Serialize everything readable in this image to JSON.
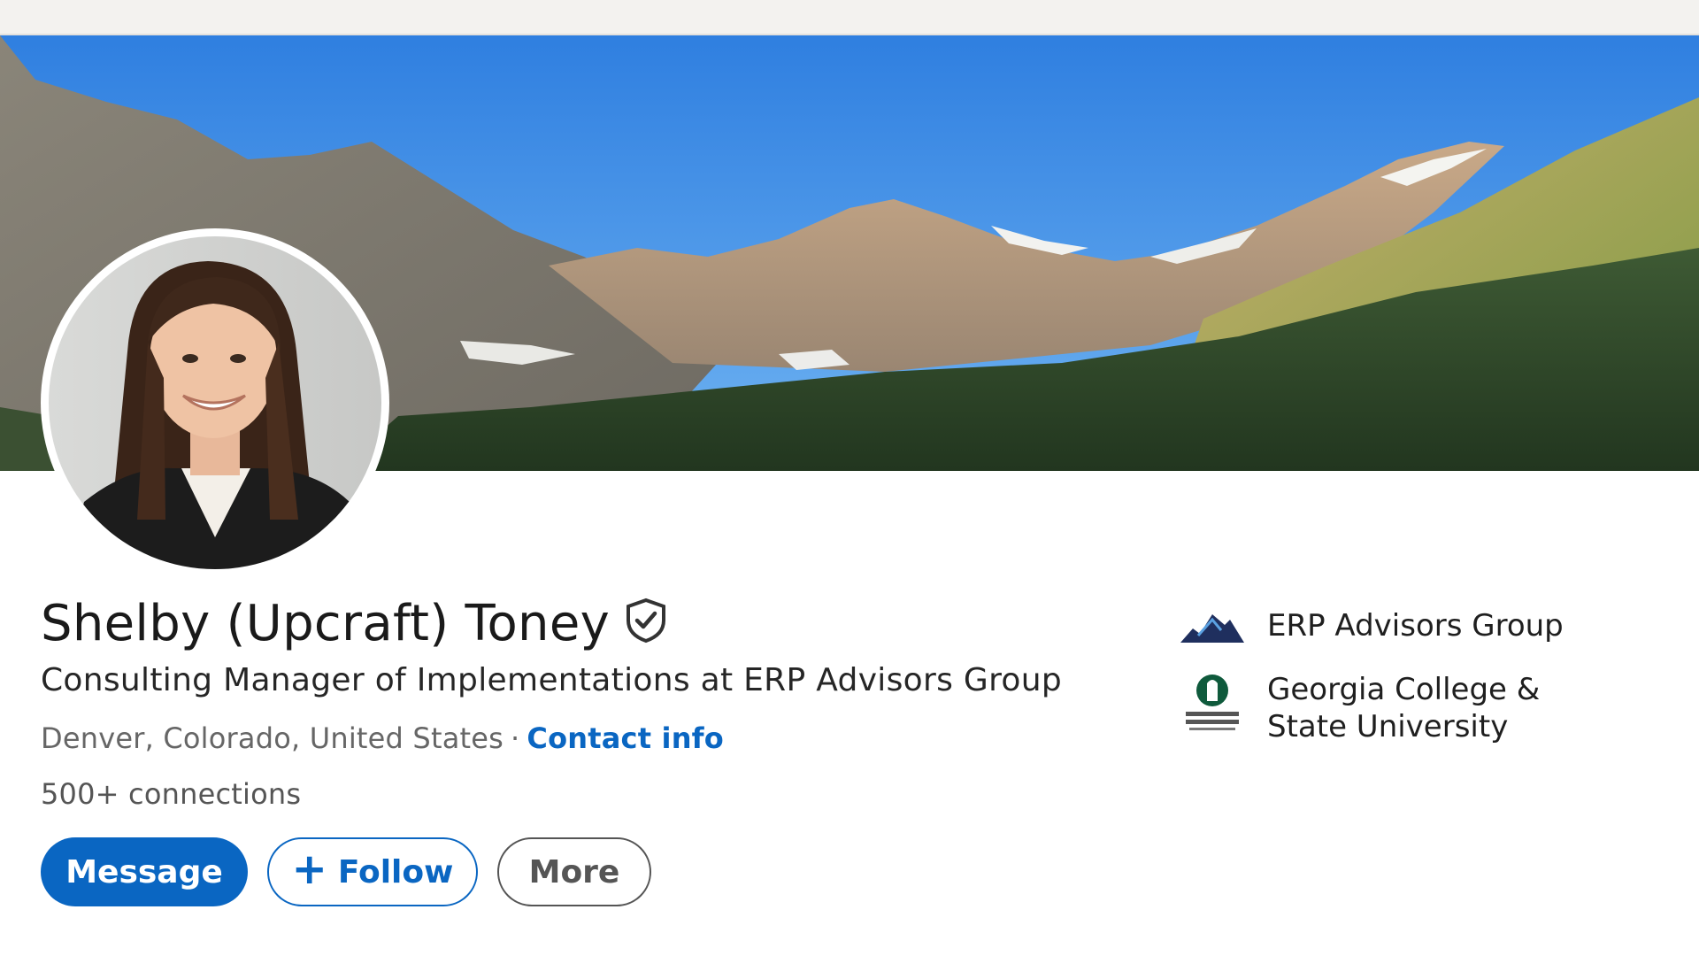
{
  "profile": {
    "name": "Shelby (Upcraft) Toney",
    "headline": "Consulting Manager of Implementations at ERP Advisors Group",
    "location": "Denver, Colorado, United States",
    "separator": "·",
    "contact_info_label": "Contact info",
    "connections": "500+ connections"
  },
  "actions": {
    "message_label": "Message",
    "follow_label": "Follow",
    "more_label": "More"
  },
  "side": {
    "company": "ERP Advisors Group",
    "school": "Georgia College & State University"
  },
  "icons": {
    "verified": "verified-shield-icon",
    "plus": "plus-icon",
    "company_logo": "erp-advisors-logo",
    "school_logo": "georgia-college-logo"
  },
  "colors": {
    "brand_blue": "#0a66c2",
    "text_primary": "#1a1a1a",
    "text_secondary": "#666666"
  }
}
